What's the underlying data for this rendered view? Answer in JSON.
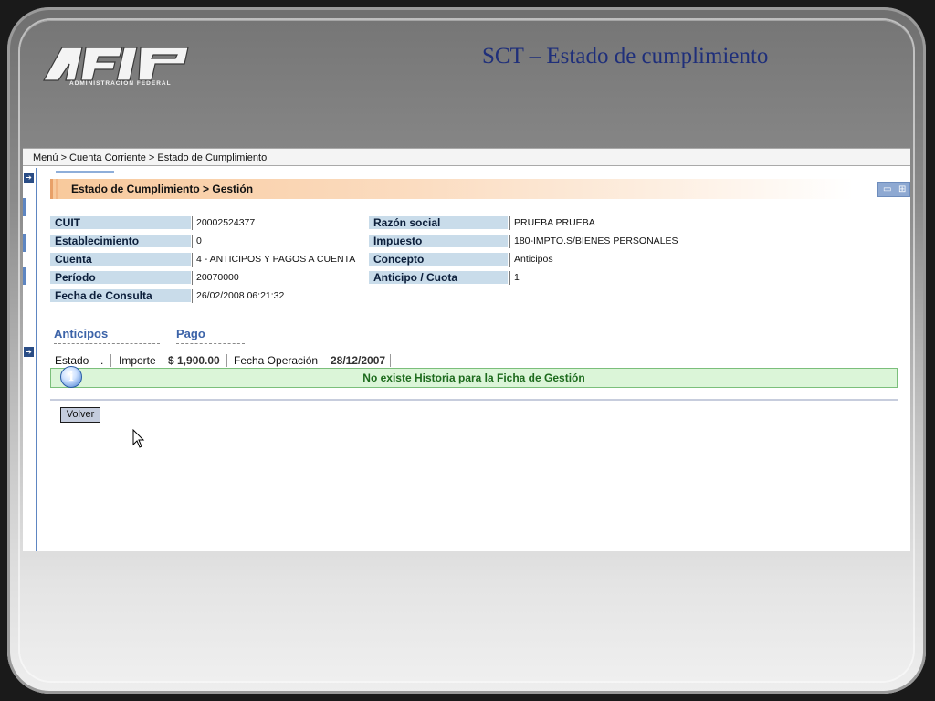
{
  "slide": {
    "logo_text": "AFIP",
    "logo_subtitle": "ADMINISTRACION FEDERAL",
    "title": "SCT – Estado de cumplimiento"
  },
  "breadcrumb": "Menú > Cuenta Corriente > Estado de Cumplimiento",
  "section_header": "Estado de Cumplimiento > Gestión",
  "fields_left": [
    {
      "label": "CUIT",
      "value": "20002524377"
    },
    {
      "label": "Establecimiento",
      "value": "0"
    },
    {
      "label": "Cuenta",
      "value": "4 - ANTICIPOS Y PAGOS A CUENTA"
    },
    {
      "label": "Período",
      "value": "20070000"
    },
    {
      "label": "Fecha de Consulta",
      "value": "26/02/2008 06:21:32"
    }
  ],
  "fields_right": [
    {
      "label": "Razón social",
      "value": "PRUEBA PRUEBA"
    },
    {
      "label": "Impuesto",
      "value": "180-IMPTO.S/BIENES PERSONALES"
    },
    {
      "label": "Concepto",
      "value": "Anticipos"
    },
    {
      "label": "Anticipo / Cuota",
      "value": "1"
    }
  ],
  "tabs": [
    {
      "label": "Anticipos"
    },
    {
      "label": "Pago"
    }
  ],
  "status_row": {
    "estado_label": "Estado",
    "estado_value": ".",
    "importe_label": "Importe",
    "importe_value": "$ 1,900.00",
    "fecha_label": "Fecha Operación",
    "fecha_value": "28/12/2007"
  },
  "info_message": "No existe Historia para la Ficha de Gestión",
  "buttons": {
    "volver": "Volver"
  },
  "colors": {
    "title": "#1f2f7a",
    "label_bg": "#c9dcea",
    "tab_text": "#3c63a8",
    "info_bg": "#dbf5d8",
    "info_text": "#1d6b1d",
    "header_accent": "#f8c99c"
  }
}
